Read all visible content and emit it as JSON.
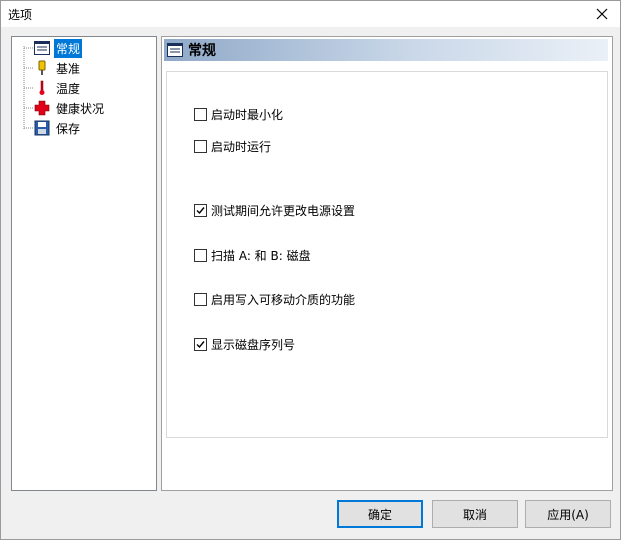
{
  "window": {
    "title": "选项"
  },
  "tree": {
    "items": [
      {
        "label": "常规",
        "icon": "general-settings-icon",
        "selected": true
      },
      {
        "label": "基准",
        "icon": "benchmark-icon",
        "selected": false
      },
      {
        "label": "温度",
        "icon": "thermometer-icon",
        "selected": false
      },
      {
        "label": "健康状况",
        "icon": "health-cross-icon",
        "selected": false
      },
      {
        "label": "保存",
        "icon": "floppy-disk-icon",
        "selected": false
      }
    ]
  },
  "panel": {
    "header": "常规",
    "options": [
      {
        "label": "启动时最小化",
        "checked": false
      },
      {
        "label": "启动时运行",
        "checked": false
      },
      {
        "label": "测试期间允许更改电源设置",
        "checked": true
      },
      {
        "label": "扫描 A: 和 B: 磁盘",
        "checked": false
      },
      {
        "label": "启用写入可移动介质的功能",
        "checked": false
      },
      {
        "label": "显示磁盘序列号",
        "checked": true
      }
    ]
  },
  "buttons": {
    "ok": "确定",
    "cancel": "取消",
    "apply": "应用(A)"
  },
  "colors": {
    "selection": "#0078d7",
    "health_red": "#e0001a"
  }
}
